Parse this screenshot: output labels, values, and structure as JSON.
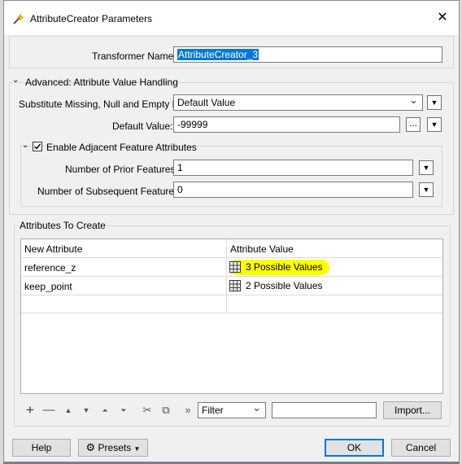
{
  "window": {
    "title": "AttributeCreator Parameters"
  },
  "transformer": {
    "name_label": "Transformer Name:",
    "name_value": "AttributeCreator_3"
  },
  "advanced": {
    "section_label": "Advanced: Attribute Value Handling",
    "substitute_label": "Substitute Missing, Null and Empty by:",
    "substitute_value": "Default Value",
    "default_label": "Default Value:",
    "default_value": "-99999",
    "ellipsis": "...",
    "adjacent": {
      "label": "Enable Adjacent Feature Attributes",
      "checked": true,
      "prior_label": "Number of Prior Features:",
      "prior_value": "1",
      "subsequent_label": "Number of Subsequent Features:",
      "subsequent_value": "0"
    }
  },
  "attributes": {
    "section_label": "Attributes To Create",
    "columns": [
      "New Attribute",
      "Attribute Value"
    ],
    "rows": [
      {
        "name": "reference_z",
        "value": "3 Possible Values",
        "highlight": "#ffff00"
      },
      {
        "name": "keep_point",
        "value": "2 Possible Values"
      }
    ]
  },
  "toolbar": {
    "icons": [
      "add-icon",
      "remove-icon",
      "move-up-icon",
      "move-down-icon",
      "move-top-icon",
      "move-bottom-icon",
      "cut-icon",
      "copy-icon",
      "more-icon"
    ],
    "filter_value": "Filter",
    "import_label": "Import..."
  },
  "footer": {
    "help": "Help",
    "presets": "Presets",
    "ok": "OK",
    "cancel": "Cancel"
  },
  "colors": {
    "accent": "#0078d7",
    "highlight": "#ffff00",
    "dialog_bg": "#f0f0f0"
  }
}
